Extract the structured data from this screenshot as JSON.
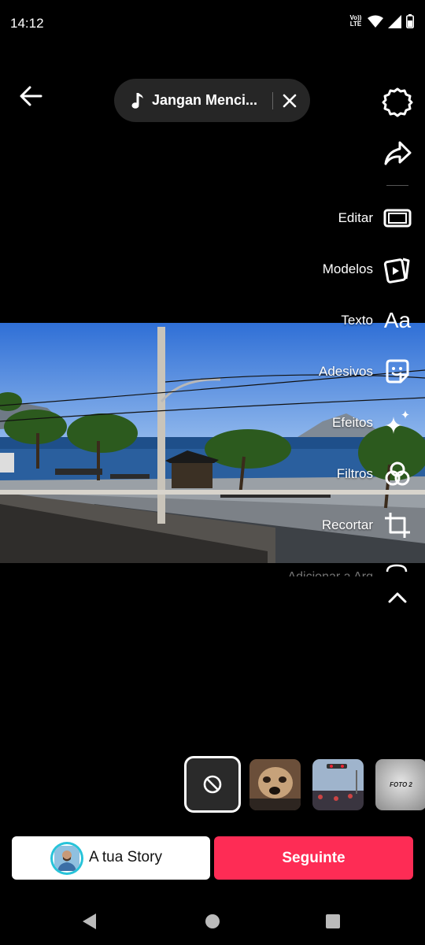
{
  "status_bar": {
    "time": "14:12",
    "volte_top": "Vo))",
    "volte_bottom": "LTE"
  },
  "music": {
    "title": "Jangan Menci..."
  },
  "tools": {
    "edit": "Editar",
    "templates": "Modelos",
    "text": "Texto",
    "text_icon": "Aa",
    "stickers": "Adesivos",
    "effects": "Efeitos",
    "filters": "Filtros",
    "crop": "Recortar",
    "more_partial": "Adicionar a Arq"
  },
  "filters_strip": {
    "thumb3_text": "FOTO 2"
  },
  "bottom": {
    "story_label": "A tua Story",
    "next_label": "Seguinte"
  },
  "colors": {
    "accent": "#fe2c55",
    "avatar_ring": "#27c3d9",
    "pill_bg": "#262626"
  }
}
